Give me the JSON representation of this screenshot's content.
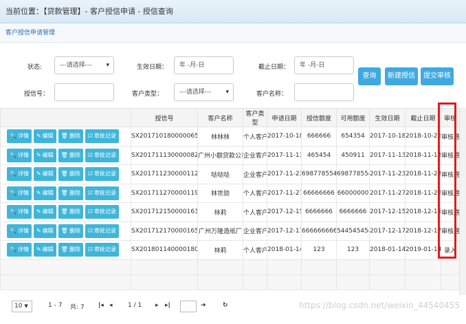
{
  "breadcrumb": "当前位置：【贷款管理】- 客户授信申请 - 授信查询",
  "panel_title": "客户授信申请管理",
  "search": {
    "status_label": "状态:",
    "status_value": "---请选择---",
    "start_date_label": "生效日期：",
    "start_date_placeholder": "年 -月-日",
    "end_date_label": "截止日期：",
    "end_date_placeholder": "年 -月-日",
    "credit_no_label": "授信号：",
    "customer_type_label": "客户类型：",
    "customer_type_value": "---请选择---",
    "customer_name_label": "客户名称："
  },
  "buttons": {
    "query": "查询",
    "new_credit": "新建授信",
    "submit_audit": "提交审核"
  },
  "actions": {
    "detail": "详情",
    "edit": "编辑",
    "delete": "删除",
    "audit_log": "审批记录"
  },
  "columns": [
    "授信号",
    "客户名称",
    "客户类型",
    "申请日期",
    "授信额度",
    "可用额度",
    "生效日期",
    "截止日期",
    "审核"
  ],
  "rows": [
    [
      "SX201710180000065",
      "林林林",
      "个人客户",
      "2017-10-18",
      "666666",
      "654354",
      "2017-10-18",
      "2018-10-26",
      "审核通过"
    ],
    [
      "SX201711130000082",
      "广州小额贷款公司",
      "企业客户",
      "2017-11-13",
      "465454",
      "450911",
      "2017-11-13",
      "2018-11-13",
      "审核通过"
    ],
    [
      "SX201711230000112",
      "哒哒哒",
      "企业客户",
      "2017-11-23",
      "698778554",
      "698778554",
      "2017-11-23",
      "2018-11-23",
      "审核通过"
    ],
    [
      "SX201711270000119",
      "林世勋",
      "个人客户",
      "2017-11-27",
      "66666666",
      "66000000",
      "2017-11-27",
      "2018-11-28",
      "审核通过"
    ],
    [
      "SX201712150000163",
      "林莉",
      "个人客户",
      "2017-12-15",
      "6666666",
      "6666666",
      "2017-12-15",
      "2018-12-15",
      "审核通过"
    ],
    [
      "SX201712170000165",
      "广州万隆造纸厂",
      "企业客户",
      "2017-12-17",
      "666666666",
      "544545454",
      "2017-12-17",
      "2018-12-17",
      "审核通过"
    ],
    [
      "SX201801140000180",
      "林莉",
      "个人客户",
      "2018-01-14",
      "123",
      "123",
      "2018-01-14",
      "2019-01-14",
      "录入"
    ]
  ],
  "pager": {
    "page_size": "10",
    "range": "1 - 7",
    "total": "共: 7",
    "page": "1 / 1"
  },
  "watermark": "https://blog.csdn.net/weixin_44540455",
  "colors": {
    "accent": "#3fa9e0",
    "action": "#3fb6d9",
    "highlight": "#e01b1b"
  }
}
